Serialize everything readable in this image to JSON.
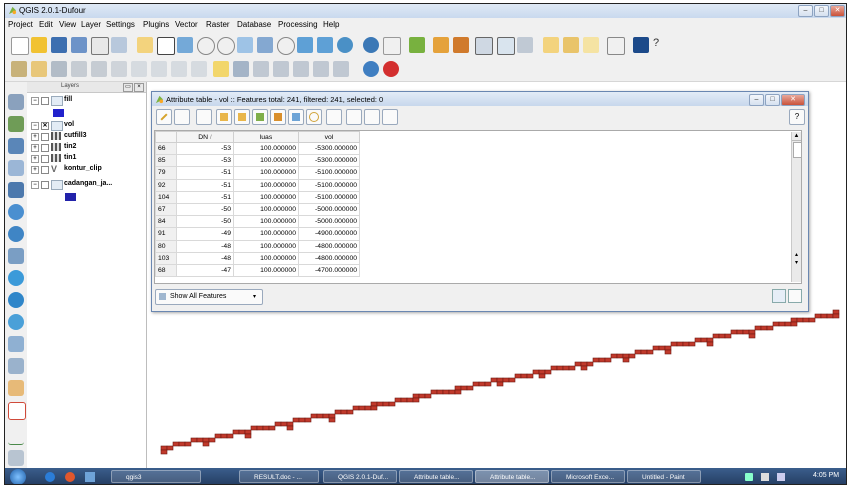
{
  "window": {
    "title": "QGIS 2.0.1-Dufour",
    "buttons": [
      "–",
      "□",
      "✕"
    ]
  },
  "menu": [
    "Project",
    "Edit",
    "View",
    "Layer",
    "Settings",
    "Plugins",
    "Vector",
    "Raster",
    "Database",
    "Processing",
    "Help"
  ],
  "layers_panel": {
    "title": "Layers",
    "items": [
      {
        "name": "fill",
        "expanded": true,
        "checked": false,
        "swatch": "#2222cc"
      },
      {
        "name": "vol",
        "expanded": true,
        "checked": true
      },
      {
        "name": "cutfill3",
        "expanded": false,
        "checked": false
      },
      {
        "name": "tin2",
        "expanded": false,
        "checked": false
      },
      {
        "name": "tin1",
        "expanded": false,
        "checked": false
      },
      {
        "name": "kontur_clip",
        "expanded": false,
        "checked": false
      },
      {
        "name": "cadangan_ja...",
        "expanded": true,
        "checked": false,
        "swatch": "#2222aa"
      }
    ]
  },
  "attribute_table": {
    "title": "Attribute table - vol :: Features total: 241, filtered: 241, selected: 0",
    "columns": [
      "DN",
      "luas",
      "vol"
    ],
    "rows": [
      {
        "id": "66",
        "DN": "-53",
        "luas": "100.000000",
        "vol": "-5300.000000"
      },
      {
        "id": "85",
        "DN": "-53",
        "luas": "100.000000",
        "vol": "-5300.000000"
      },
      {
        "id": "79",
        "DN": "-51",
        "luas": "100.000000",
        "vol": "-5100.000000"
      },
      {
        "id": "92",
        "DN": "-51",
        "luas": "100.000000",
        "vol": "-5100.000000"
      },
      {
        "id": "104",
        "DN": "-51",
        "luas": "100.000000",
        "vol": "-5100.000000"
      },
      {
        "id": "67",
        "DN": "-50",
        "luas": "100.000000",
        "vol": "-5000.000000"
      },
      {
        "id": "84",
        "DN": "-50",
        "luas": "100.000000",
        "vol": "-5000.000000"
      },
      {
        "id": "91",
        "DN": "-49",
        "luas": "100.000000",
        "vol": "-4900.000000"
      },
      {
        "id": "80",
        "DN": "-48",
        "luas": "100.000000",
        "vol": "-4800.000000"
      },
      {
        "id": "103",
        "DN": "-48",
        "luas": "100.000000",
        "vol": "-4800.000000"
      },
      {
        "id": "68",
        "DN": "-47",
        "luas": "100.000000",
        "vol": "-4700.000000"
      }
    ],
    "show_all_label": "Show All Features",
    "help_label": "?"
  },
  "map": {
    "feature_color": "#c0392b",
    "feature_edge": "#6e1a12"
  },
  "taskbar": {
    "tasks": [
      "qgis3",
      "RESULT.doc - ...",
      "QGIS 2.0.1-Duf...",
      "Attribute table...",
      "Attribute table...",
      "Microsoft Exce...",
      "Untitled - Paint"
    ],
    "clock": "4:05 PM"
  }
}
